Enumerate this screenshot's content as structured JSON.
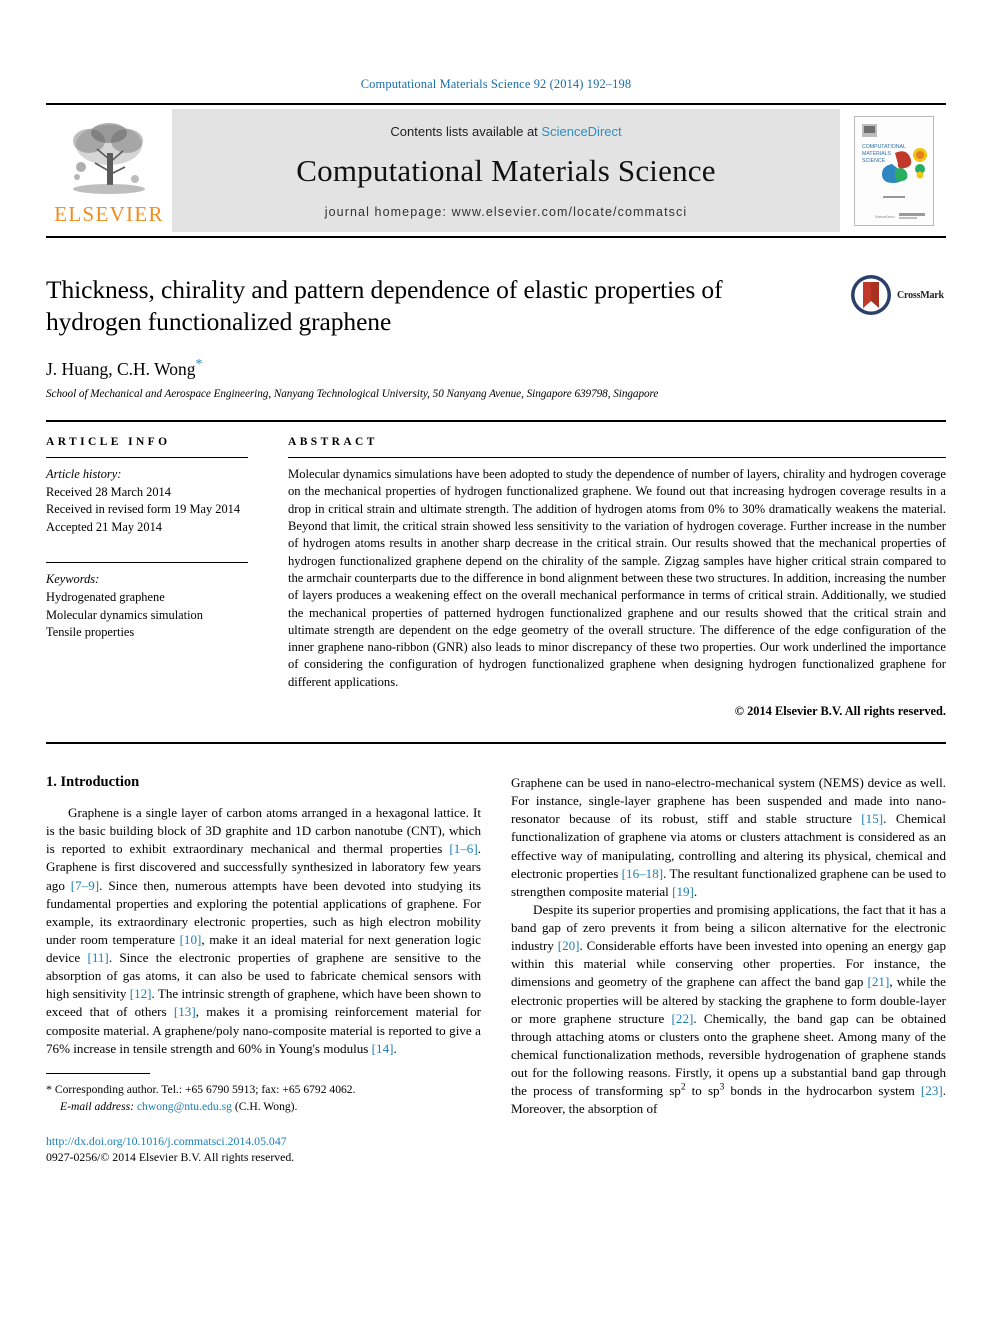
{
  "running_head": "Computational Materials Science 92 (2014) 192–198",
  "masthead": {
    "publisher_name": "ELSEVIER",
    "contents_prefix": "Contents lists available at",
    "contents_link": "ScienceDirect",
    "journal_title": "Computational Materials Science",
    "homepage": "journal homepage: www.elsevier.com/locate/commatsci",
    "cover_title": "COMPUTATIONAL MATERIALS SCIENCE",
    "colors": {
      "link": "#2a8fc4",
      "elsevier_orange": "#f08c1e",
      "band_background": "#e3e3e3",
      "running_head": "#1a6ea8"
    }
  },
  "article": {
    "title": "Thickness, chirality and pattern dependence of elastic properties of hydrogen functionalized graphene",
    "authors": "J. Huang, C.H. Wong",
    "corresponding_marker": "*",
    "affiliation": "School of Mechanical and Aerospace Engineering, Nanyang Technological University, 50 Nanyang Avenue, Singapore 639798, Singapore",
    "crossmark_label": "CrossMark"
  },
  "article_info": {
    "heading": "ARTICLE INFO",
    "history_label": "Article history:",
    "history": [
      "Received 28 March 2014",
      "Received in revised form 19 May 2014",
      "Accepted 21 May 2014"
    ],
    "keywords_label": "Keywords:",
    "keywords": [
      "Hydrogenated graphene",
      "Molecular dynamics simulation",
      "Tensile properties"
    ]
  },
  "abstract": {
    "heading": "ABSTRACT",
    "text": "Molecular dynamics simulations have been adopted to study the dependence of number of layers, chirality and hydrogen coverage on the mechanical properties of hydrogen functionalized graphene. We found out that increasing hydrogen coverage results in a drop in critical strain and ultimate strength. The addition of hydrogen atoms from 0% to 30% dramatically weakens the material. Beyond that limit, the critical strain showed less sensitivity to the variation of hydrogen coverage. Further increase in the number of hydrogen atoms results in another sharp decrease in the critical strain. Our results showed that the mechanical properties of hydrogen functionalized graphene depend on the chirality of the sample. Zigzag samples have higher critical strain compared to the armchair counterparts due to the difference in bond alignment between these two structures. In addition, increasing the number of layers produces a weakening effect on the overall mechanical performance in terms of critical strain. Additionally, we studied the mechanical properties of patterned hydrogen functionalized graphene and our results showed that the critical strain and ultimate strength are dependent on the edge geometry of the overall structure. The difference of the edge configuration of the inner graphene nano-ribbon (GNR) also leads to minor discrepancy of these two properties. Our work underlined the importance of considering the configuration of hydrogen functionalized graphene when designing hydrogen functionalized graphene for different applications.",
    "copyright": "© 2014 Elsevier B.V. All rights reserved."
  },
  "introduction": {
    "heading": "1. Introduction",
    "left_paragraph_1_a": "Graphene is a single layer of carbon atoms arranged in a hexagonal lattice. It is the basic building block of 3D graphite and 1D carbon nanotube (CNT), which is reported to exhibit extraordinary mechanical and thermal properties ",
    "ref_1_6": "[1–6]",
    "left_paragraph_1_b": ". Graphene is first discovered and successfully synthesized in laboratory few years ago ",
    "ref_7_9": "[7–9]",
    "left_paragraph_1_c": ". Since then, numerous attempts have been devoted into studying its fundamental properties and exploring the potential applications of graphene. For example, its extraordinary electronic properties, such as high electron mobility under room temperature ",
    "ref_10": "[10]",
    "left_paragraph_1_d": ", make it an ideal material for next generation logic device ",
    "ref_11": "[11]",
    "left_paragraph_1_e": ". Since the electronic properties of graphene are sensitive to the absorption of gas atoms, it can also be used to fabricate chemical sensors with high sensitivity ",
    "ref_12": "[12]",
    "left_paragraph_1_f": ". The intrinsic strength of graphene, which have been shown to exceed that of others ",
    "ref_13": "[13]",
    "left_paragraph_1_g": ", makes it a promising reinforcement material for composite material. A graphene/poly nano-composite material is reported to give a 76% increase in tensile strength and 60% in Young's modulus ",
    "ref_14": "[14]",
    "left_paragraph_1_h": ".",
    "right_paragraph_1_a": "Graphene can be used in nano-electro-mechanical system (NEMS) device as well. For instance, single-layer graphene has been suspended and made into nano-resonator because of its robust, stiff and stable structure ",
    "ref_15": "[15]",
    "right_paragraph_1_b": ". Chemical functionalization of graphene via atoms or clusters attachment is considered as an effective way of manipulating, controlling and altering its physical, chemical and electronic properties ",
    "ref_16_18": "[16–18]",
    "right_paragraph_1_c": ". The resultant functionalized graphene can be used to strengthen composite material ",
    "ref_19": "[19]",
    "right_paragraph_1_d": ".",
    "right_paragraph_2_a": "Despite its superior properties and promising applications, the fact that it has a band gap of zero prevents it from being a silicon alternative for the electronic industry ",
    "ref_20": "[20]",
    "right_paragraph_2_b": ". Considerable efforts have been invested into opening an energy gap within this material while conserving other properties. For instance, the dimensions and geometry of the graphene can affect the band gap ",
    "ref_21": "[21]",
    "right_paragraph_2_c": ", while the electronic properties will be altered by stacking the graphene to form double-layer or more graphene structure ",
    "ref_22": "[22]",
    "right_paragraph_2_d": ". Chemically, the band gap can be obtained through attaching atoms or clusters onto the graphene sheet. Among many of the chemical functionalization methods, reversible hydrogenation of graphene stands out for the following reasons. Firstly, it opens up a substantial band gap through the process of transforming sp",
    "sup_2": "2",
    "right_paragraph_2_e": " to sp",
    "sup_3": "3",
    "right_paragraph_2_f": " bonds in the hydrocarbon system ",
    "ref_23": "[23]",
    "right_paragraph_2_g": ". Moreover, the absorption of"
  },
  "footnotes": {
    "corresponding_marker": "*",
    "corresponding_text": "Corresponding author. Tel.: +65 6790 5913; fax: +65 6792 4062.",
    "email_label": "E-mail address:",
    "email": "chwong@ntu.edu.sg",
    "email_owner": "(C.H. Wong).",
    "doi": "http://dx.doi.org/10.1016/j.commatsci.2014.05.047",
    "issn_line": "0927-0256/© 2014 Elsevier B.V. All rights reserved."
  }
}
